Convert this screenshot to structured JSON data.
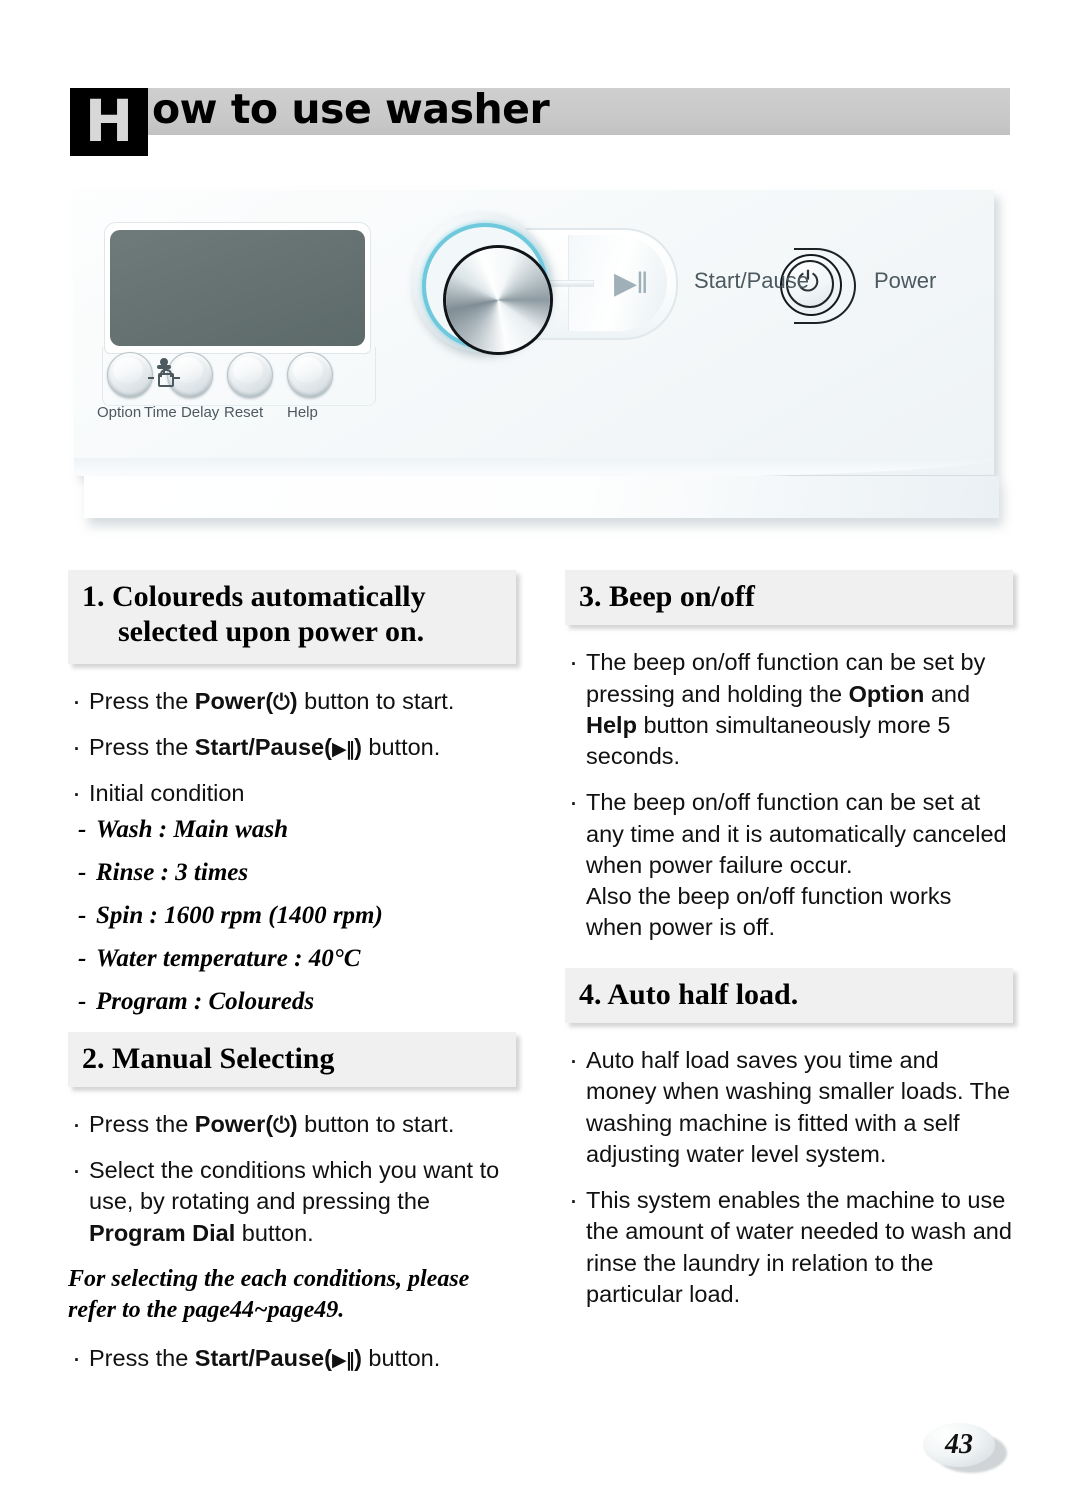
{
  "header": {
    "dropcap": "H",
    "title": "ow to use washer",
    "bar_color": "#c8c8c8"
  },
  "illustration": {
    "name": "washer-control-panel-diagram",
    "lcd_color": "#667272",
    "dial_ring_color": "#6ec9dd",
    "buttons": [
      {
        "label": "Option"
      },
      {
        "label": "Time Delay"
      },
      {
        "label": "Reset"
      },
      {
        "label": "Help"
      }
    ],
    "child_lock_icon": "child-lock-icon",
    "program_dial": "program-dial",
    "start_pause_label": "Start/Pause",
    "start_pause_glyph": "▶‖",
    "power_label": "Power",
    "power_glyph": "⏻"
  },
  "sections": {
    "s1": {
      "number": "1.",
      "title_line1": "Coloureds automatically",
      "title_line2": "selected upon power on.",
      "bullets": [
        {
          "pre": "Press the ",
          "bold": "Power",
          "sym_open": "(",
          "sym": "⏻",
          "sym_close": ")",
          "post": " button to start."
        },
        {
          "pre": "Press the ",
          "bold": "Start/Pause",
          "sym_open": "(",
          "sym": "▶‖",
          "sym_close": ")",
          "post": " button."
        }
      ],
      "plain_bullet": "Initial condition",
      "conditions": [
        "Wash :  Main wash",
        "Rinse : 3 times",
        "Spin : 1600 rpm (1400 rpm)",
        "Water temperature : 40°C",
        "Program : Coloureds"
      ]
    },
    "s2": {
      "number": "2.",
      "title": "Manual Selecting",
      "b1_pre": "Press the ",
      "b1_bold": "Power",
      "b1_sym": "⏻",
      "b1_post": " button to start.",
      "b2_pre": "Select the conditions which you want to use, by rotating and pressing the ",
      "b2_bold": "Program Dial",
      "b2_post": " button.",
      "note": "For selecting the each conditions, please refer to the page44~page49.",
      "b3_pre": "Press the ",
      "b3_bold": "Start/Pause",
      "b3_sym": "▶‖",
      "b3_post": " button."
    },
    "s3": {
      "number": "3.",
      "title": "Beep on/off",
      "b1_pre": "The beep on/off function can be set by pressing and holding the ",
      "b1_bold1": "Option",
      "b1_mid": " and ",
      "b1_bold2": "Help",
      "b1_post": " button simultaneously more 5 seconds.",
      "b2_line1": "The beep on/off function can be set at any time and it is automatically canceled when power failure occur.",
      "b2_line2": "Also the beep on/off function works when power is off."
    },
    "s4": {
      "number": "4.",
      "title": "Auto half load.",
      "b1": "Auto half load saves you time and money when washing smaller loads. The washing machine is fitted with a self adjusting water level system.",
      "b2": "This system enables the machine to use the amount of water needed to wash and rinse the laundry in relation to the particular load."
    }
  },
  "footer": {
    "page_number": "43"
  }
}
